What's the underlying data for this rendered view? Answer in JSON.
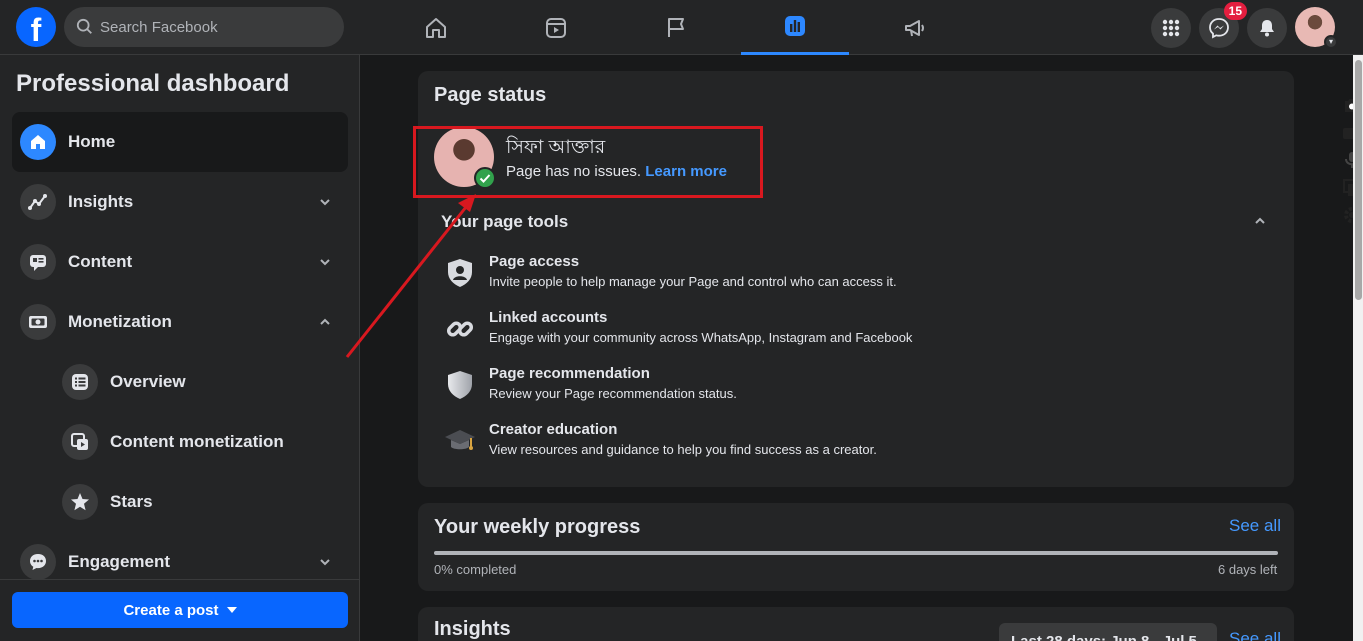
{
  "topbar": {
    "logo_letter": "f",
    "search_placeholder": "Search Facebook",
    "nav_tabs": [
      "home-icon",
      "watch-icon",
      "pages-flag-icon",
      "dashboard-icon",
      "ad-center-megaphone-icon"
    ],
    "active_tab": "dashboard-icon",
    "messenger_badge": "15"
  },
  "sidebar": {
    "title": "Professional dashboard",
    "items": [
      {
        "label": "Home",
        "icon": "home-icon",
        "active": true
      },
      {
        "label": "Insights",
        "icon": "insights-icon",
        "chevron": "down"
      },
      {
        "label": "Content",
        "icon": "content-icon",
        "chevron": "down"
      },
      {
        "label": "Monetization",
        "icon": "monetization-icon",
        "chevron": "up"
      },
      {
        "label": "Overview",
        "icon": "overview-icon",
        "sub": true
      },
      {
        "label": "Content monetization",
        "icon": "content-monetization-icon",
        "sub": true
      },
      {
        "label": "Stars",
        "icon": "stars-icon",
        "sub": true
      },
      {
        "label": "Engagement",
        "icon": "engagement-icon",
        "chevron": "down"
      }
    ],
    "create_post": "Create a post"
  },
  "page_status": {
    "title": "Page status",
    "page_name": "সিফা আক্তার",
    "status_text": "Page has no issues.",
    "learn_more": "Learn more",
    "tools_title": "Your page tools",
    "tools": [
      {
        "title": "Page access",
        "desc": "Invite people to help manage your Page and control who can access it.",
        "icon": "shield-person-icon"
      },
      {
        "title": "Linked accounts",
        "desc": "Engage with your community across WhatsApp, Instagram and Facebook",
        "icon": "link-icon"
      },
      {
        "title": "Page recommendation",
        "desc": "Review your Page recommendation status.",
        "icon": "shield-icon"
      },
      {
        "title": "Creator education",
        "desc": "View resources and guidance to help you find success as a creator.",
        "icon": "graduation-cap-icon"
      }
    ]
  },
  "weekly_progress": {
    "title": "Your weekly progress",
    "see_all": "See all",
    "percent": 0,
    "completed_text": "0% completed",
    "days_left": "6 days left"
  },
  "insights": {
    "title": "Insights",
    "date_range": "Last 28 days: Jun 8 - Jul 5",
    "see_all": "See all"
  },
  "colors": {
    "accent": "#2d88ff",
    "annotation_red": "#d8181f"
  }
}
